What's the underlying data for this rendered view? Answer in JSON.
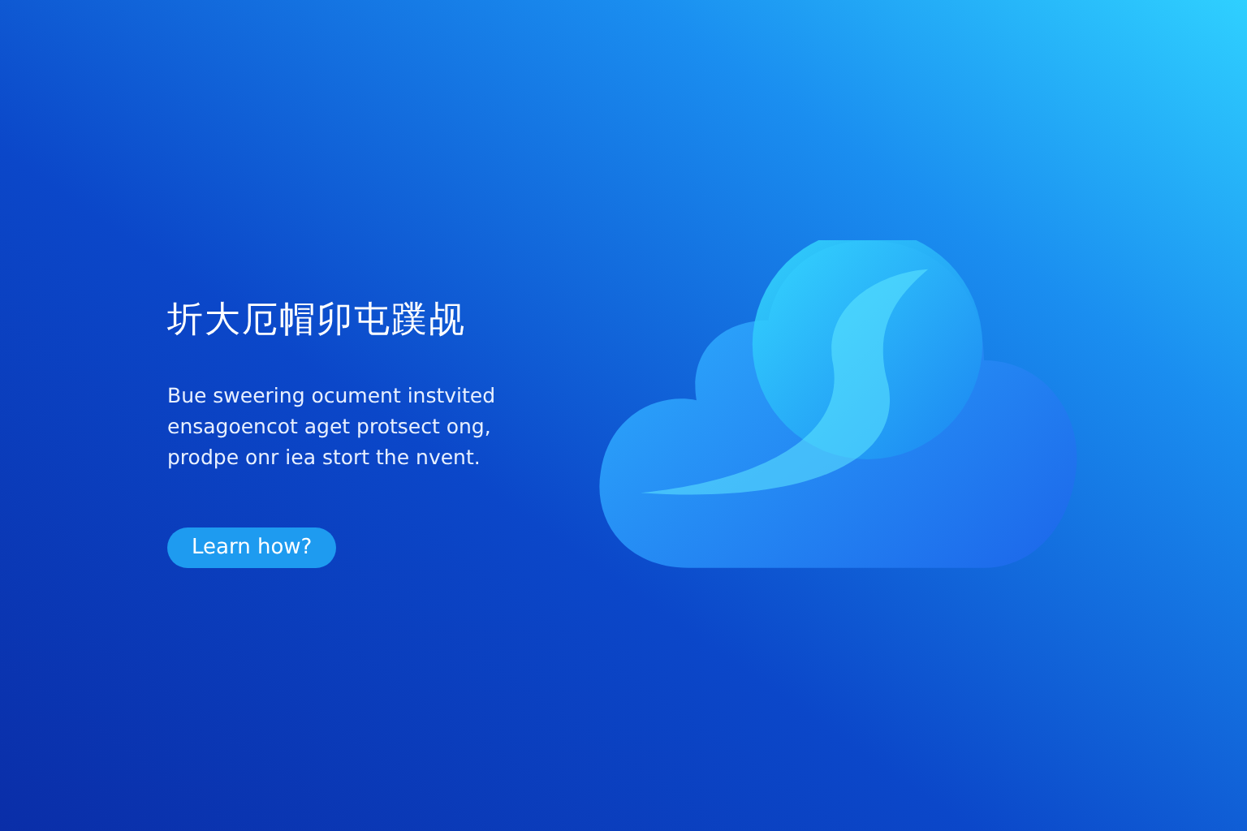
{
  "hero": {
    "heading": "圻大厄帽卯屯蹼觇",
    "body_lines": [
      "Bue sweering ocument instvited",
      "ensagoencot aget protsect ong,",
      "prodpe onr iea stort the nvent."
    ],
    "button": {
      "label": "Learn how?"
    }
  }
}
